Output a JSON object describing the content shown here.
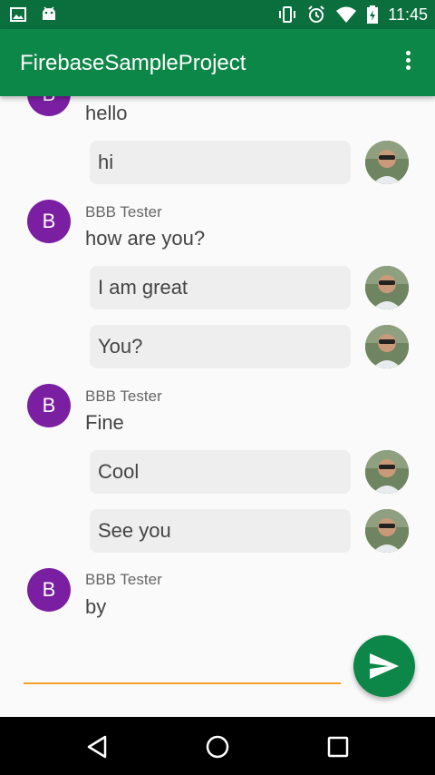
{
  "status_bar": {
    "time": "11:45"
  },
  "app_bar": {
    "title": "FirebaseSampleProject"
  },
  "messages": {
    "m0": {
      "text": "hello"
    },
    "m1": {
      "text": "hi"
    },
    "m2": {
      "sender": "BBB Tester",
      "avatar_letter": "B",
      "text": "how are you?"
    },
    "m3": {
      "text": "I am great"
    },
    "m4": {
      "text": "You?"
    },
    "m5": {
      "sender": "BBB Tester",
      "avatar_letter": "B",
      "text": "Fine"
    },
    "m6": {
      "text": "Cool"
    },
    "m7": {
      "text": "See you"
    },
    "m8": {
      "sender": "BBB Tester",
      "avatar_letter": "B",
      "text": "by"
    },
    "m0_avatar": "B"
  },
  "composer": {
    "value": ""
  },
  "colors": {
    "status_bar": "#0a6e3d",
    "app_bar": "#0d8748",
    "avatar": "#7b1fa2",
    "input_underline": "#f5a028",
    "fab": "#0d8748"
  },
  "icons": [
    "picture-icon",
    "android-icon",
    "vibrate-icon",
    "alarm-icon",
    "wifi-icon",
    "battery-charging-icon",
    "overflow-menu-icon",
    "send-icon",
    "back-icon",
    "home-icon",
    "recents-icon"
  ]
}
